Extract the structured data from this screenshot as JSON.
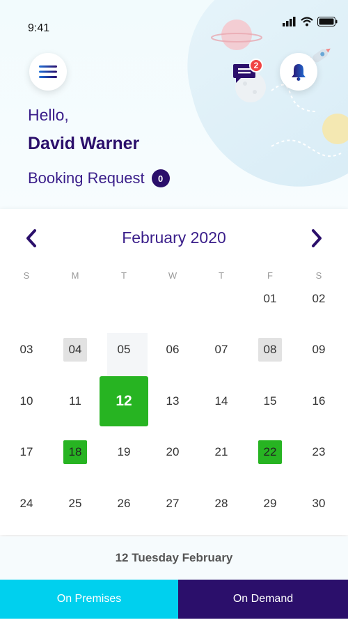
{
  "status_bar": {
    "time": "9:41"
  },
  "header": {
    "greeting": "Hello,",
    "user_name": "David Warner",
    "booking_label": "Booking Request",
    "booking_count": "0",
    "chat_badge": "2"
  },
  "calendar": {
    "month_label": "February 2020",
    "weekdays": [
      "S",
      "M",
      "T",
      "W",
      "T",
      "F",
      "S"
    ],
    "weeks": [
      [
        "",
        "",
        "",
        "",
        "",
        "01",
        "02"
      ],
      [
        "03",
        "04",
        "05",
        "06",
        "07",
        "08",
        "09"
      ],
      [
        "10",
        "11",
        "12",
        "13",
        "14",
        "15",
        "16"
      ],
      [
        "17",
        "18",
        "19",
        "20",
        "21",
        "22",
        "23"
      ],
      [
        "24",
        "25",
        "26",
        "27",
        "28",
        "29",
        "30"
      ]
    ],
    "selected": "12",
    "gray_days": [
      "04",
      "08"
    ],
    "green_days": [
      "18",
      "22"
    ]
  },
  "selected_date_label": "12 Tuesday February",
  "tabs": {
    "premises": "On Premises",
    "demand": "On Demand"
  },
  "colors": {
    "primary": "#2b0f6b",
    "accent_green": "#27b422",
    "accent_cyan": "#00d0ee",
    "badge_red": "#f04444"
  }
}
